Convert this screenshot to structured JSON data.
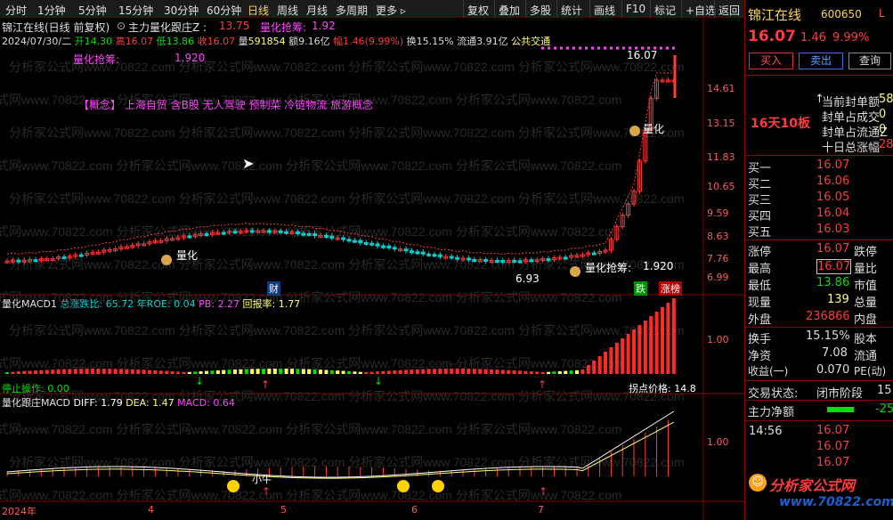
{
  "toolbar": {
    "left": [
      "分时",
      "1分钟",
      "5分钟",
      "15分钟",
      "30分钟",
      "60分钟",
      "日线",
      "周线",
      "月线",
      "多周期",
      "更多 ▹"
    ],
    "right": [
      "复权",
      "叠加",
      "多股",
      "统计",
      "画线",
      "F10",
      "标记",
      "+自选",
      "返回"
    ]
  },
  "header": {
    "stock": "锦江在线(日线 前复权)",
    "indicator": "主力量化跟庄Z :",
    "indicator_value": "13.75",
    "signal_label": "量化抢筹:",
    "signal_value": "1.92",
    "date": "2024/07/30/二",
    "open_label": "开",
    "open": "14.30",
    "high_label": "高",
    "high": "16.07",
    "low_label": "低",
    "low": "13.86",
    "close_label": "收",
    "close": "16.07",
    "vol_label": "量",
    "vol": "591854",
    "amount": "额9.16亿",
    "amp_label": "幅",
    "amp": "1.46(9.99%)",
    "turnover": "换15.15%",
    "float": "流通3.91亿",
    "sector": "公共交通"
  },
  "main": {
    "qh_label": "量化抢筹:",
    "qh_value": "1.920",
    "concept": "【概念】 上海自贸 含B股 无人驾驶 预制菜 冷链物流 旅游概念",
    "watermark": "分析家公式网www.70822.com",
    "label_qh1": "量化",
    "label_qh2": "量化",
    "label_qh3": "量化抢筹:",
    "label_qh3v": "1.920",
    "peak": "16.07",
    "low": "6.93",
    "cai": "财",
    "die": "跌",
    "zhangbang": "涨榜",
    "ticks": [
      "14.61",
      "13.15",
      "11.83",
      "10.65",
      "9.59",
      "8.63",
      "7.76",
      "6.99"
    ]
  },
  "macd1": {
    "title": "量化MACD1",
    "zdb": "总涨跌比: 65.72",
    "roe": "年ROE: 0.04",
    "pb": "PB: 2.27",
    "hbl": "回报率: 1.77",
    "stop": "停止操作: 0.00",
    "guaidian": "拐点价格: 14.8",
    "tick": "1.00"
  },
  "macd2": {
    "title": "量化跟庄MACD",
    "diff": "DIFF: 1.79",
    "dea": "DEA: 1.47",
    "macd": "MACD: 0.64",
    "xiaoniu": "小牛",
    "tick": "1.00"
  },
  "xaxis": [
    "2024年",
    "4",
    "5",
    "6",
    "7"
  ],
  "right_panel": {
    "name": "锦江在线",
    "code": "600650",
    "mark": "L",
    "price": "16.07",
    "change": "1.46",
    "pct": "9.99%",
    "buy": "买入",
    "sell": "卖出",
    "query": "查询",
    "board": "16天10板",
    "info_labels": [
      "当前封单额",
      "封单占成交",
      "封单占流通Z",
      "十日总涨幅"
    ],
    "info_values": [
      "58",
      "0",
      "0",
      "28"
    ],
    "bids_labels": [
      "买一",
      "买二",
      "买三",
      "买四",
      "买五"
    ],
    "bids": [
      "16.07",
      "16.06",
      "16.05",
      "16.04",
      "16.03"
    ],
    "q1_labels": [
      "涨停",
      "最高",
      "最低",
      "现量",
      "外盘"
    ],
    "q1_values": [
      "16.07",
      "16.07",
      "13.86",
      "139",
      "236866"
    ],
    "q1_right": [
      "跌停",
      "量比",
      "市值",
      "总量",
      "内盘"
    ],
    "q2_labels": [
      "换手",
      "净资",
      "收益(一)"
    ],
    "q2_values": [
      "15.15%",
      "7.08",
      "0.070"
    ],
    "q2_right": [
      "股本",
      "流通",
      "PE(动)"
    ],
    "trade_label": "交易状态:",
    "trade_val": "闭市阶段",
    "trade_num": "15",
    "net_label": "主力净额",
    "net_val": "-25",
    "tick_time": "14:56",
    "tick_prices": [
      "16.07",
      "16.07",
      "16.07"
    ],
    "logo": "分析家公式网",
    "logo_url": "www.70822.com"
  },
  "colors": {
    "red": "#ff3b3b",
    "green": "#00d0d0",
    "yellow": "#ffff66",
    "magenta": "#ff44ff",
    "dark_red": "#8a0000"
  },
  "icons": [
    "moneybag-icon",
    "smile-icon",
    "up-arrow-icon",
    "down-arrow-icon",
    "cursor-icon",
    "settings-circle-icon"
  ]
}
